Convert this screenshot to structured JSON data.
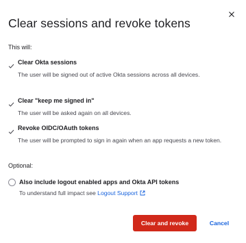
{
  "dialog": {
    "title": "Clear sessions and revoke tokens",
    "close_icon": "close-icon",
    "intro": "This will:",
    "items": [
      {
        "icon": "checkmark-icon",
        "title": "Clear Okta sessions",
        "desc": "The user will be signed out of active Okta sessions across all devices."
      },
      {
        "icon": "checkmark-icon",
        "title": "Clear \"keep me signed in\"",
        "desc": "The user will be asked again on all devices."
      },
      {
        "icon": "checkmark-icon",
        "title": "Revoke OIDC/OAuth tokens",
        "desc": "The user will be prompted to sign in again when an app requests a new token."
      }
    ],
    "optional_label": "Optional:",
    "option": {
      "label": "Also include logout enabled apps and Okta API tokens",
      "desc_prefix": "To understand full impact see",
      "link_text": "Logout Support",
      "link_icon": "external-link-icon",
      "checked": false
    },
    "buttons": {
      "primary": "Clear and revoke",
      "cancel": "Cancel"
    },
    "colors": {
      "danger": "#d1291a",
      "link": "#1662dd",
      "text": "#1d1d21",
      "muted": "#46464e"
    }
  }
}
